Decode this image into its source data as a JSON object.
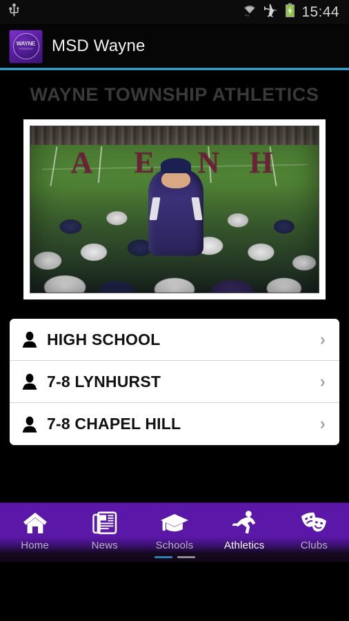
{
  "status_bar": {
    "usb_icon": "usb-icon",
    "wifi_icon": "wifi-icon",
    "airplane_icon": "airplane-mode-icon",
    "battery_icon": "battery-charging-icon",
    "time": "15:44"
  },
  "action_bar": {
    "app_icon": "msd-wayne-logo-icon",
    "logo_word": "WAYNE",
    "logo_sub": "TOWNSHIP",
    "title": "MSD Wayne"
  },
  "content": {
    "page_title": "WAYNE TOWNSHIP ATHLETICS",
    "hero_photo_alt": "youth football team huddle with coach on field"
  },
  "list": {
    "rows": [
      {
        "icon": "person-icon",
        "label": "HIGH SCHOOL",
        "chevron": "›"
      },
      {
        "icon": "person-icon",
        "label": "7-8 LYNHURST",
        "chevron": "›"
      },
      {
        "icon": "person-icon",
        "label": "7-8 CHAPEL HILL",
        "chevron": "›"
      }
    ]
  },
  "bottom_nav": {
    "items": [
      {
        "icon": "home-icon",
        "label": "Home",
        "active": false
      },
      {
        "icon": "newspaper-icon",
        "label": "News",
        "active": false
      },
      {
        "icon": "graduation-cap-icon",
        "label": "Schools",
        "active": false
      },
      {
        "icon": "running-person-icon",
        "label": "Athletics",
        "active": true
      },
      {
        "icon": "theater-masks-icon",
        "label": "Clubs",
        "active": false
      }
    ],
    "page_dots": [
      {
        "active": true
      },
      {
        "active": false
      }
    ]
  },
  "colors": {
    "nav_purple": "#5b18a8",
    "accent_blue": "#3eb2e0",
    "battery_green": "#8ec63f",
    "card_white": "#ffffff",
    "page_title_gray": "#3a3a3a"
  }
}
